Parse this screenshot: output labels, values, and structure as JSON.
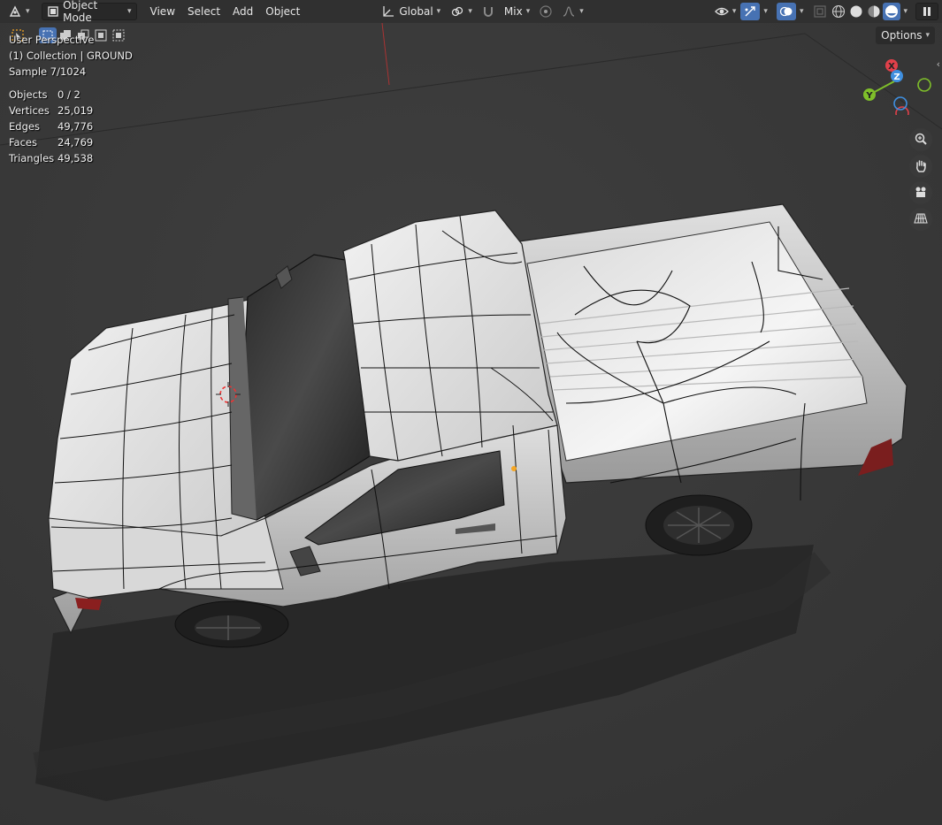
{
  "header": {
    "mode_label": "Object Mode",
    "menus": [
      "View",
      "Select",
      "Add",
      "Object"
    ],
    "transform_orientation": "Global",
    "snap_label": "Mix"
  },
  "toolbar2": {
    "options_label": "Options"
  },
  "viewport": {
    "perspective": "User Perspective",
    "collection": "(1) Collection | GROUND",
    "sample": "Sample 7/1024",
    "stats": [
      {
        "label": "Objects",
        "value": "0 / 2"
      },
      {
        "label": "Vertices",
        "value": "25,019"
      },
      {
        "label": "Edges",
        "value": "49,776"
      },
      {
        "label": "Faces",
        "value": "24,769"
      },
      {
        "label": "Triangles",
        "value": "49,538"
      }
    ]
  },
  "gizmo": {
    "x_label": "X",
    "y_label": "Y",
    "z_label": "Z",
    "x_color": "#e0404a",
    "y_color": "#7fbf2a",
    "z_color": "#3f8fe0"
  },
  "icons": {
    "zoom": "zoom-icon",
    "pan": "hand-icon",
    "camera": "camera-icon",
    "grid": "grid-icon"
  },
  "colors": {
    "header_bg": "#303030",
    "accent": "#4772b3",
    "viewport_bg": "#3a3a3a"
  }
}
